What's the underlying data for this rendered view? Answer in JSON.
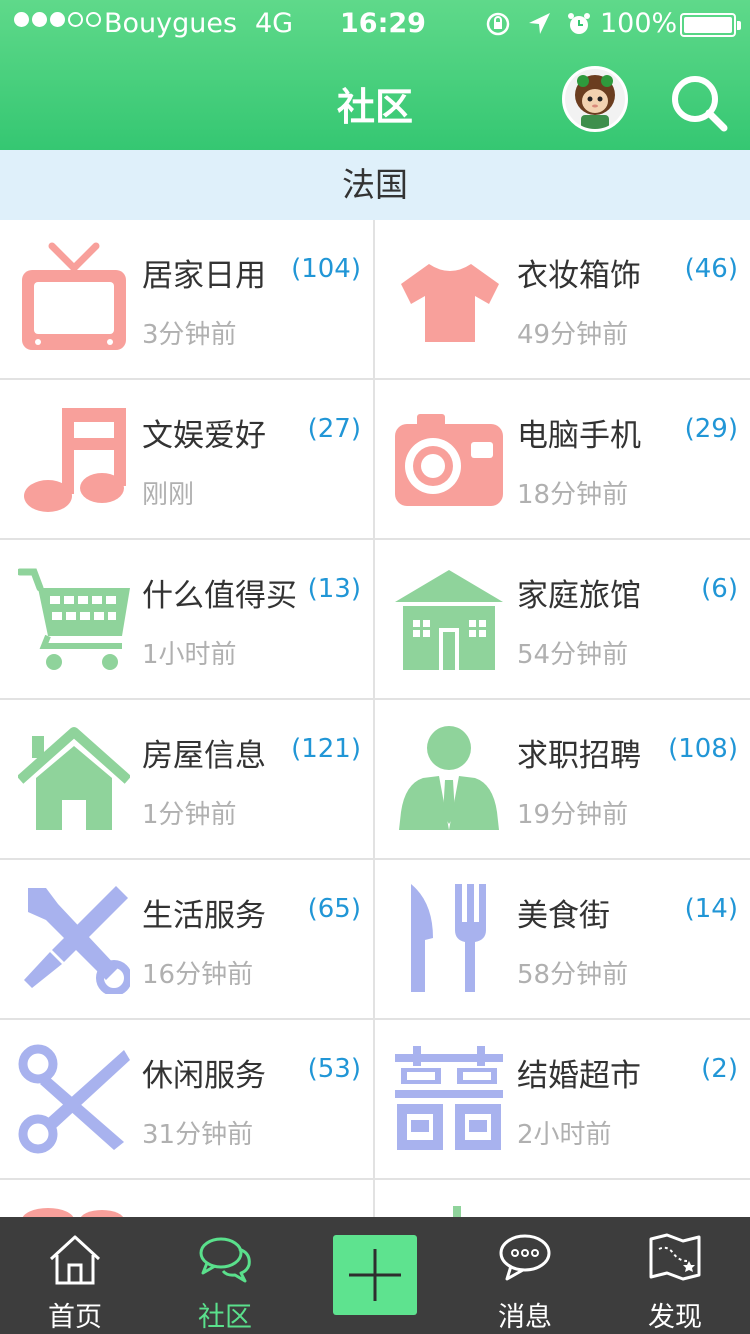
{
  "status_bar": {
    "carrier": "Bouygues",
    "network": "4G",
    "time": "16:29",
    "battery": "100%"
  },
  "header": {
    "title": "社区"
  },
  "region": "法国",
  "categories": [
    {
      "name": "居家日用",
      "count": "(104)",
      "time": "3分钟前",
      "icon": "tv-icon",
      "color": "#f8a09b"
    },
    {
      "name": "衣妆箱饰",
      "count": "(46)",
      "time": "49分钟前",
      "icon": "tshirt-icon",
      "color": "#f8a09b"
    },
    {
      "name": "文娱爱好",
      "count": "(27)",
      "time": "刚刚",
      "icon": "music-note-icon",
      "color": "#f8a09b"
    },
    {
      "name": "电脑手机",
      "count": "(29)",
      "time": "18分钟前",
      "icon": "camera-icon",
      "color": "#f8a09b"
    },
    {
      "name": "什么值得买",
      "count": "(13)",
      "time": "1小时前",
      "icon": "shopping-cart-icon",
      "color": "#8fd39b"
    },
    {
      "name": "家庭旅馆",
      "count": "(6)",
      "time": "54分钟前",
      "icon": "house-icon",
      "color": "#8fd39b"
    },
    {
      "name": "房屋信息",
      "count": "(121)",
      "time": "1分钟前",
      "icon": "home-icon",
      "color": "#8fd39b"
    },
    {
      "name": "求职招聘",
      "count": "(108)",
      "time": "19分钟前",
      "icon": "businessman-icon",
      "color": "#8fd39b"
    },
    {
      "name": "生活服务",
      "count": "(65)",
      "time": "16分钟前",
      "icon": "tools-icon",
      "color": "#a8b2ee"
    },
    {
      "name": "美食街",
      "count": "(14)",
      "time": "58分钟前",
      "icon": "knife-fork-icon",
      "color": "#a8b2ee"
    },
    {
      "name": "休闲服务",
      "count": "(53)",
      "time": "31分钟前",
      "icon": "scissors-icon",
      "color": "#a8b2ee"
    },
    {
      "name": "结婚超市",
      "count": "(2)",
      "time": "2小时前",
      "icon": "double-happiness-icon",
      "color": "#a8b2ee"
    }
  ],
  "tabs": [
    {
      "label": "首页",
      "icon": "home-outline-icon"
    },
    {
      "label": "社区",
      "icon": "chat-bubbles-icon"
    },
    {
      "label": "",
      "icon": "plus-icon"
    },
    {
      "label": "消息",
      "icon": "message-bubble-icon"
    },
    {
      "label": "发现",
      "icon": "map-icon"
    }
  ],
  "colors": {
    "header_green": "#35c772",
    "accent_green": "#5ae08c",
    "count_blue": "#2196d6",
    "region_bg": "#dff0fa",
    "tabbar_bg": "#3d3d3d"
  }
}
